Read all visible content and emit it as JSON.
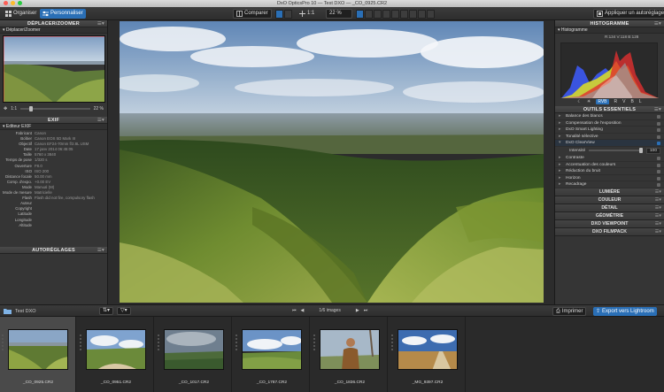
{
  "window": {
    "title": "DxO OpticsPro 10 — Test DXO — _CO_0925.CR2"
  },
  "toolbar": {
    "organize": "Organiser",
    "customize": "Personnaliser",
    "compare": "Comparer",
    "zoom_ratio": "1:1",
    "zoom_pct": "22 %",
    "auto_preset": "Appliquer un autoréglage"
  },
  "left_panel": {
    "nav_title": "DÉPLACER/ZOOMER",
    "nav_sub": "Déplacer/Zoomer",
    "nav_ratio": "1:1",
    "nav_pct": "22 %",
    "exif_title": "EXIF",
    "exif_sub": "Éditeur EXIF",
    "exif": [
      {
        "k": "Fabricant",
        "v": "Canon"
      },
      {
        "k": "Boîtier",
        "v": "Canon EOS 5D Mark III"
      },
      {
        "k": "Objectif",
        "v": "Canon EF24-70mm f/2.8L USM"
      },
      {
        "k": "Date",
        "v": "17 janv 2014 06:45:05"
      },
      {
        "k": "Taille",
        "v": "5760 x 3840"
      },
      {
        "k": "Temps de pose",
        "v": "1/320 s"
      },
      {
        "k": "Ouverture",
        "v": "F8.0"
      },
      {
        "k": "ISO",
        "v": "ISO 200"
      },
      {
        "k": "Distance focale",
        "v": "50.00 mm"
      },
      {
        "k": "Comp. d'expo.",
        "v": "+0.00 EV"
      },
      {
        "k": "Mode",
        "v": "Manual (M)"
      },
      {
        "k": "Mode de mesure",
        "v": "Matricielle"
      },
      {
        "k": "Flash",
        "v": "Flash did not fire, compulsory flash"
      },
      {
        "k": "Auteur",
        "v": ""
      },
      {
        "k": "Copyright",
        "v": ""
      },
      {
        "k": "Latitude",
        "v": ""
      },
      {
        "k": "Longitude",
        "v": ""
      },
      {
        "k": "Altitude",
        "v": ""
      }
    ],
    "presets_title": "AUTORÉGLAGES"
  },
  "right_panel": {
    "histo_title": "HISTOGRAMME",
    "histo_sub": "Histogramme",
    "rgb_readout": "R:134 V:118 B:128",
    "channels": [
      "RVB",
      "R",
      "V",
      "B",
      "L"
    ],
    "essentials_title": "OUTILS ESSENTIELS",
    "tools_top": [
      "Balance des blancs",
      "Compensation de l'exposition",
      "DxO Smart Lighting",
      "Tonalité sélective"
    ],
    "clearview": "DxO ClearView",
    "intensity_label": "Intensité",
    "intensity_value": "100",
    "tools_bottom": [
      "Contraste",
      "Accentuation des couleurs",
      "Réduction du bruit",
      "Horizon",
      "Recadrage"
    ],
    "sections": [
      "LUMIÈRE",
      "COULEUR",
      "DÉTAIL",
      "GÉOMÉTRIE",
      "DXO VIEWPOINT",
      "DXO FILMPACK"
    ]
  },
  "filmstrip": {
    "folder": "Test DXO",
    "count": "1/6 images",
    "print": "Imprimer",
    "export": "Export vers Lightroom",
    "items": [
      "_CO_0925.CR2",
      "_CO_0951.CR2",
      "_CO_1017.CR2",
      "_CO_1787.CR2",
      "_CO_1836.CR2",
      "_MG_9397.CR2"
    ]
  },
  "colors": {
    "accent": "#2a6fb6",
    "panel": "#353535",
    "bg": "#2b2b2b"
  }
}
